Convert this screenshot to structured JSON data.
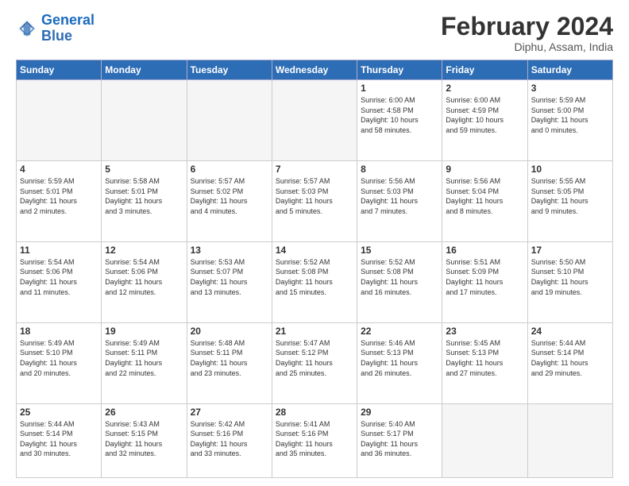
{
  "logo": {
    "line1": "General",
    "line2": "Blue"
  },
  "title": "February 2024",
  "subtitle": "Diphu, Assam, India",
  "days_of_week": [
    "Sunday",
    "Monday",
    "Tuesday",
    "Wednesday",
    "Thursday",
    "Friday",
    "Saturday"
  ],
  "weeks": [
    [
      {
        "day": "",
        "info": ""
      },
      {
        "day": "",
        "info": ""
      },
      {
        "day": "",
        "info": ""
      },
      {
        "day": "",
        "info": ""
      },
      {
        "day": "1",
        "info": "Sunrise: 6:00 AM\nSunset: 4:58 PM\nDaylight: 10 hours\nand 58 minutes."
      },
      {
        "day": "2",
        "info": "Sunrise: 6:00 AM\nSunset: 4:59 PM\nDaylight: 10 hours\nand 59 minutes."
      },
      {
        "day": "3",
        "info": "Sunrise: 5:59 AM\nSunset: 5:00 PM\nDaylight: 11 hours\nand 0 minutes."
      }
    ],
    [
      {
        "day": "4",
        "info": "Sunrise: 5:59 AM\nSunset: 5:01 PM\nDaylight: 11 hours\nand 2 minutes."
      },
      {
        "day": "5",
        "info": "Sunrise: 5:58 AM\nSunset: 5:01 PM\nDaylight: 11 hours\nand 3 minutes."
      },
      {
        "day": "6",
        "info": "Sunrise: 5:57 AM\nSunset: 5:02 PM\nDaylight: 11 hours\nand 4 minutes."
      },
      {
        "day": "7",
        "info": "Sunrise: 5:57 AM\nSunset: 5:03 PM\nDaylight: 11 hours\nand 5 minutes."
      },
      {
        "day": "8",
        "info": "Sunrise: 5:56 AM\nSunset: 5:03 PM\nDaylight: 11 hours\nand 7 minutes."
      },
      {
        "day": "9",
        "info": "Sunrise: 5:56 AM\nSunset: 5:04 PM\nDaylight: 11 hours\nand 8 minutes."
      },
      {
        "day": "10",
        "info": "Sunrise: 5:55 AM\nSunset: 5:05 PM\nDaylight: 11 hours\nand 9 minutes."
      }
    ],
    [
      {
        "day": "11",
        "info": "Sunrise: 5:54 AM\nSunset: 5:06 PM\nDaylight: 11 hours\nand 11 minutes."
      },
      {
        "day": "12",
        "info": "Sunrise: 5:54 AM\nSunset: 5:06 PM\nDaylight: 11 hours\nand 12 minutes."
      },
      {
        "day": "13",
        "info": "Sunrise: 5:53 AM\nSunset: 5:07 PM\nDaylight: 11 hours\nand 13 minutes."
      },
      {
        "day": "14",
        "info": "Sunrise: 5:52 AM\nSunset: 5:08 PM\nDaylight: 11 hours\nand 15 minutes."
      },
      {
        "day": "15",
        "info": "Sunrise: 5:52 AM\nSunset: 5:08 PM\nDaylight: 11 hours\nand 16 minutes."
      },
      {
        "day": "16",
        "info": "Sunrise: 5:51 AM\nSunset: 5:09 PM\nDaylight: 11 hours\nand 17 minutes."
      },
      {
        "day": "17",
        "info": "Sunrise: 5:50 AM\nSunset: 5:10 PM\nDaylight: 11 hours\nand 19 minutes."
      }
    ],
    [
      {
        "day": "18",
        "info": "Sunrise: 5:49 AM\nSunset: 5:10 PM\nDaylight: 11 hours\nand 20 minutes."
      },
      {
        "day": "19",
        "info": "Sunrise: 5:49 AM\nSunset: 5:11 PM\nDaylight: 11 hours\nand 22 minutes."
      },
      {
        "day": "20",
        "info": "Sunrise: 5:48 AM\nSunset: 5:11 PM\nDaylight: 11 hours\nand 23 minutes."
      },
      {
        "day": "21",
        "info": "Sunrise: 5:47 AM\nSunset: 5:12 PM\nDaylight: 11 hours\nand 25 minutes."
      },
      {
        "day": "22",
        "info": "Sunrise: 5:46 AM\nSunset: 5:13 PM\nDaylight: 11 hours\nand 26 minutes."
      },
      {
        "day": "23",
        "info": "Sunrise: 5:45 AM\nSunset: 5:13 PM\nDaylight: 11 hours\nand 27 minutes."
      },
      {
        "day": "24",
        "info": "Sunrise: 5:44 AM\nSunset: 5:14 PM\nDaylight: 11 hours\nand 29 minutes."
      }
    ],
    [
      {
        "day": "25",
        "info": "Sunrise: 5:44 AM\nSunset: 5:14 PM\nDaylight: 11 hours\nand 30 minutes."
      },
      {
        "day": "26",
        "info": "Sunrise: 5:43 AM\nSunset: 5:15 PM\nDaylight: 11 hours\nand 32 minutes."
      },
      {
        "day": "27",
        "info": "Sunrise: 5:42 AM\nSunset: 5:16 PM\nDaylight: 11 hours\nand 33 minutes."
      },
      {
        "day": "28",
        "info": "Sunrise: 5:41 AM\nSunset: 5:16 PM\nDaylight: 11 hours\nand 35 minutes."
      },
      {
        "day": "29",
        "info": "Sunrise: 5:40 AM\nSunset: 5:17 PM\nDaylight: 11 hours\nand 36 minutes."
      },
      {
        "day": "",
        "info": ""
      },
      {
        "day": "",
        "info": ""
      }
    ]
  ]
}
